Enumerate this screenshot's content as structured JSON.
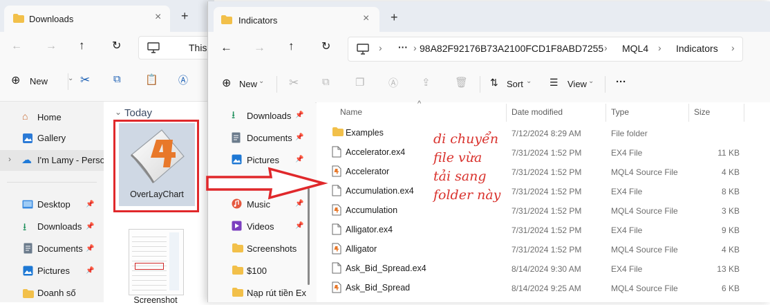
{
  "back_window": {
    "tab_title": "Downloads",
    "address_text": "This",
    "new_label": "New",
    "nav": {
      "home": "Home",
      "gallery": "Gallery",
      "cloud": "I'm Lamy - Perso",
      "desktop": "Desktop",
      "downloads": "Downloads",
      "documents": "Documents",
      "pictures": "Pictures",
      "doanh_so": "Doanh số"
    },
    "group_label": "Today",
    "files": [
      {
        "name": "OverLayChart",
        "icon": "mql4-file-icon"
      },
      {
        "name": "Screenshot",
        "icon": "image-thumbnail"
      }
    ]
  },
  "front_window": {
    "tab_title": "Indicators",
    "breadcrumb": {
      "ellipsis": "···",
      "items": [
        "98A82F92176B73A2100FCD1F8ABD7255",
        "MQL4",
        "Indicators"
      ]
    },
    "command_bar": {
      "new_label": "New",
      "sort_label": "Sort",
      "view_label": "View",
      "more_label": "···"
    },
    "nav": [
      {
        "label": "Downloads",
        "icon": "download-arrow-icon",
        "pinned": true
      },
      {
        "label": "Documents",
        "icon": "document-icon",
        "pinned": true
      },
      {
        "label": "Pictures",
        "icon": "picture-icon",
        "pinned": true
      },
      {
        "label": "Doanh số",
        "icon": "folder-icon",
        "pinned": true
      },
      {
        "label": "Music",
        "icon": "music-icon",
        "pinned": true
      },
      {
        "label": "Videos",
        "icon": "video-icon",
        "pinned": true
      },
      {
        "label": "Screenshots",
        "icon": "folder-icon",
        "pinned": false
      },
      {
        "label": "$100",
        "icon": "folder-icon",
        "pinned": false
      },
      {
        "label": "Nạp rút tiền Exn",
        "icon": "folder-icon",
        "pinned": false
      }
    ],
    "columns": {
      "name": "Name",
      "date": "Date modified",
      "type": "Type",
      "size": "Size"
    },
    "files": [
      {
        "name": "Examples",
        "date": "7/12/2024 8:29 AM",
        "type": "File folder",
        "size": "",
        "icon": "folder"
      },
      {
        "name": "Accelerator.ex4",
        "date": "7/31/2024 1:52 PM",
        "type": "EX4 File",
        "size": "11 KB",
        "icon": "ex4"
      },
      {
        "name": "Accelerator",
        "date": "7/31/2024 1:52 PM",
        "type": "MQL4 Source File",
        "size": "4 KB",
        "icon": "mq4"
      },
      {
        "name": "Accumulation.ex4",
        "date": "7/31/2024 1:52 PM",
        "type": "EX4 File",
        "size": "8 KB",
        "icon": "ex4"
      },
      {
        "name": "Accumulation",
        "date": "7/31/2024 1:52 PM",
        "type": "MQL4 Source File",
        "size": "3 KB",
        "icon": "mq4"
      },
      {
        "name": "Alligator.ex4",
        "date": "7/31/2024 1:52 PM",
        "type": "EX4 File",
        "size": "9 KB",
        "icon": "ex4"
      },
      {
        "name": "Alligator",
        "date": "7/31/2024 1:52 PM",
        "type": "MQL4 Source File",
        "size": "4 KB",
        "icon": "mq4"
      },
      {
        "name": "Ask_Bid_Spread.ex4",
        "date": "8/14/2024 9:30 AM",
        "type": "EX4 File",
        "size": "13 KB",
        "icon": "ex4"
      },
      {
        "name": "Ask_Bid_Spread",
        "date": "8/14/2024 9:25 AM",
        "type": "MQL4 Source File",
        "size": "6 KB",
        "icon": "mq4"
      }
    ]
  },
  "annotation": {
    "lines": [
      "di chuyển",
      "file vừa",
      "tải sang",
      "folder này"
    ],
    "color": "#d9322d"
  },
  "colors": {
    "folder": "#f2c04a",
    "highlight_box": "#e0282b",
    "mq4_accent": "#e8782a",
    "selected_nav": "#e6e6e6"
  }
}
